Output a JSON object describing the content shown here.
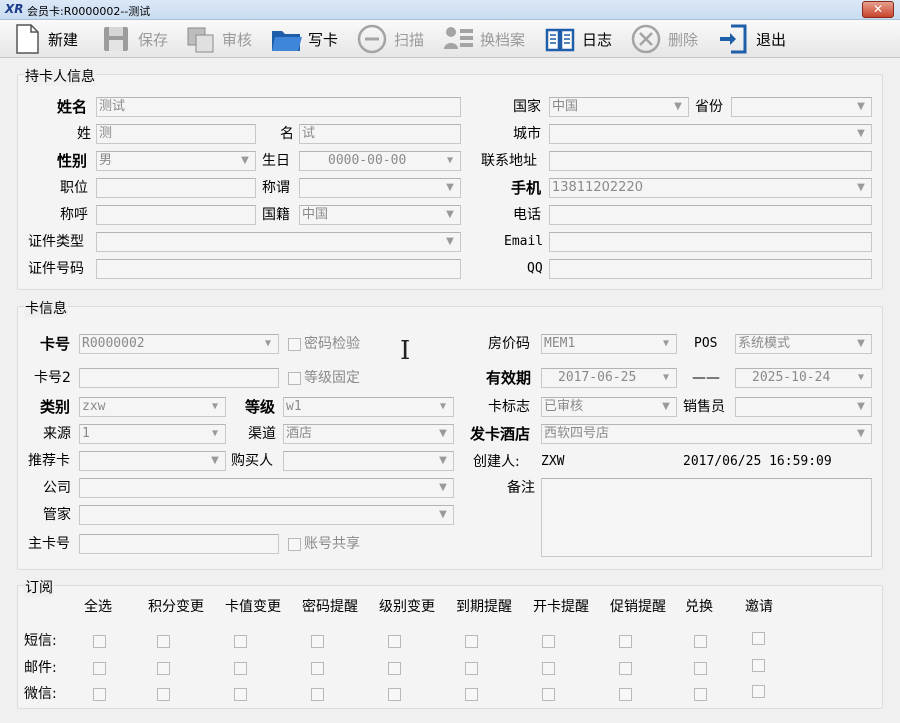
{
  "window": {
    "logo": "XR",
    "title": "会员卡:R0000002--测试",
    "close": "✕"
  },
  "toolbar": {
    "new": "新建",
    "save": "保存",
    "audit": "审核",
    "write_card": "写卡",
    "scan": "扫描",
    "change_file": "换档案",
    "log": "日志",
    "delete": "删除",
    "exit": "退出"
  },
  "holder": {
    "group_title": "持卡人信息",
    "name_label": "姓名",
    "name_value": "测试",
    "surname_label": "姓",
    "surname_value": "测",
    "given_label": "名",
    "given_value": "试",
    "gender_label": "性别",
    "gender_value": "男",
    "birthday_label": "生日",
    "birthday_value": "0000-00-00",
    "position_label": "职位",
    "position_value": "",
    "appellation_label": "称谓",
    "appellation_value": "",
    "salutation_label": "称呼",
    "salutation_value": "",
    "nationality_label": "国籍",
    "nationality_value": "中国",
    "idtype_label": "证件类型",
    "idtype_value": "",
    "idno_label": "证件号码",
    "idno_value": "",
    "country_label": "国家",
    "country_value": "中国",
    "province_label": "省份",
    "province_value": "",
    "city_label": "城市",
    "city_value": "",
    "address_label": "联系地址",
    "address_value": "",
    "mobile_label": "手机",
    "mobile_value": "13811202220",
    "phone_label": "电话",
    "phone_value": "",
    "email_label": "Email",
    "email_value": "",
    "qq_label": "QQ",
    "qq_value": ""
  },
  "card": {
    "group_title": "卡信息",
    "cardno_label": "卡号",
    "cardno_value": "R0000002",
    "pwd_check": "密码检验",
    "cardno2_label": "卡号2",
    "cardno2_value": "",
    "level_fixed": "等级固定",
    "type_label": "类别",
    "type_value": "zxw",
    "level_label": "等级",
    "level_value": "w1",
    "source_label": "来源",
    "source_value": "1",
    "channel_label": "渠道",
    "channel_value": "酒店",
    "referrer_label": "推荐卡",
    "referrer_value": "",
    "buyer_label": "购买人",
    "buyer_value": "",
    "company_label": "公司",
    "company_value": "",
    "butler_label": "管家",
    "butler_value": "",
    "master_label": "主卡号",
    "master_value": "",
    "share_account": "账号共享",
    "rate_label": "房价码",
    "rate_value": "MEM1",
    "pos_label": "POS",
    "pos_value": "系统模式",
    "valid_label": "有效期",
    "valid_from": "2017-06-25",
    "valid_sep": "——",
    "valid_to": "2025-10-24",
    "flag_label": "卡标志",
    "flag_value": "已审核",
    "sales_label": "销售员",
    "sales_value": "",
    "hotel_label": "发卡酒店",
    "hotel_value": "西软四号店",
    "creator_label": "创建人:",
    "creator_value": "ZXW",
    "created_at": "2017/06/25 16:59:09",
    "remark_label": "备注",
    "remark_value": ""
  },
  "subscribe": {
    "group_title": "订阅",
    "columns": [
      "全选",
      "积分变更",
      "卡值变更",
      "密码提醒",
      "级别变更",
      "到期提醒",
      "开卡提醒",
      "促销提醒",
      "兑换",
      "邀请"
    ],
    "rows": [
      "短信:",
      "邮件:",
      "微信:"
    ]
  },
  "colors": {
    "field_bg": "#f5f5f5",
    "disabled_text": "#9a9a9a",
    "toolbar_blue": "#1f5ea8"
  }
}
